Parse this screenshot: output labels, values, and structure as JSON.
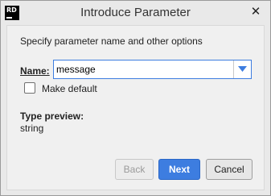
{
  "window": {
    "title": "Introduce Parameter",
    "app_icon_text": "RD",
    "app_icon_name": "rider-app-icon",
    "close_glyph": "✕"
  },
  "dialog": {
    "prompt": "Specify parameter name and other options",
    "name_label": "Name:",
    "name_value": "message",
    "make_default_label": "Make default",
    "make_default_checked": false,
    "type_preview_heading": "Type preview:",
    "type_preview_value": "string"
  },
  "buttons": {
    "back": "Back",
    "back_enabled": false,
    "next": "Next",
    "cancel": "Cancel"
  },
  "colors": {
    "accent": "#3d7de0",
    "background": "#f0f0f0"
  }
}
